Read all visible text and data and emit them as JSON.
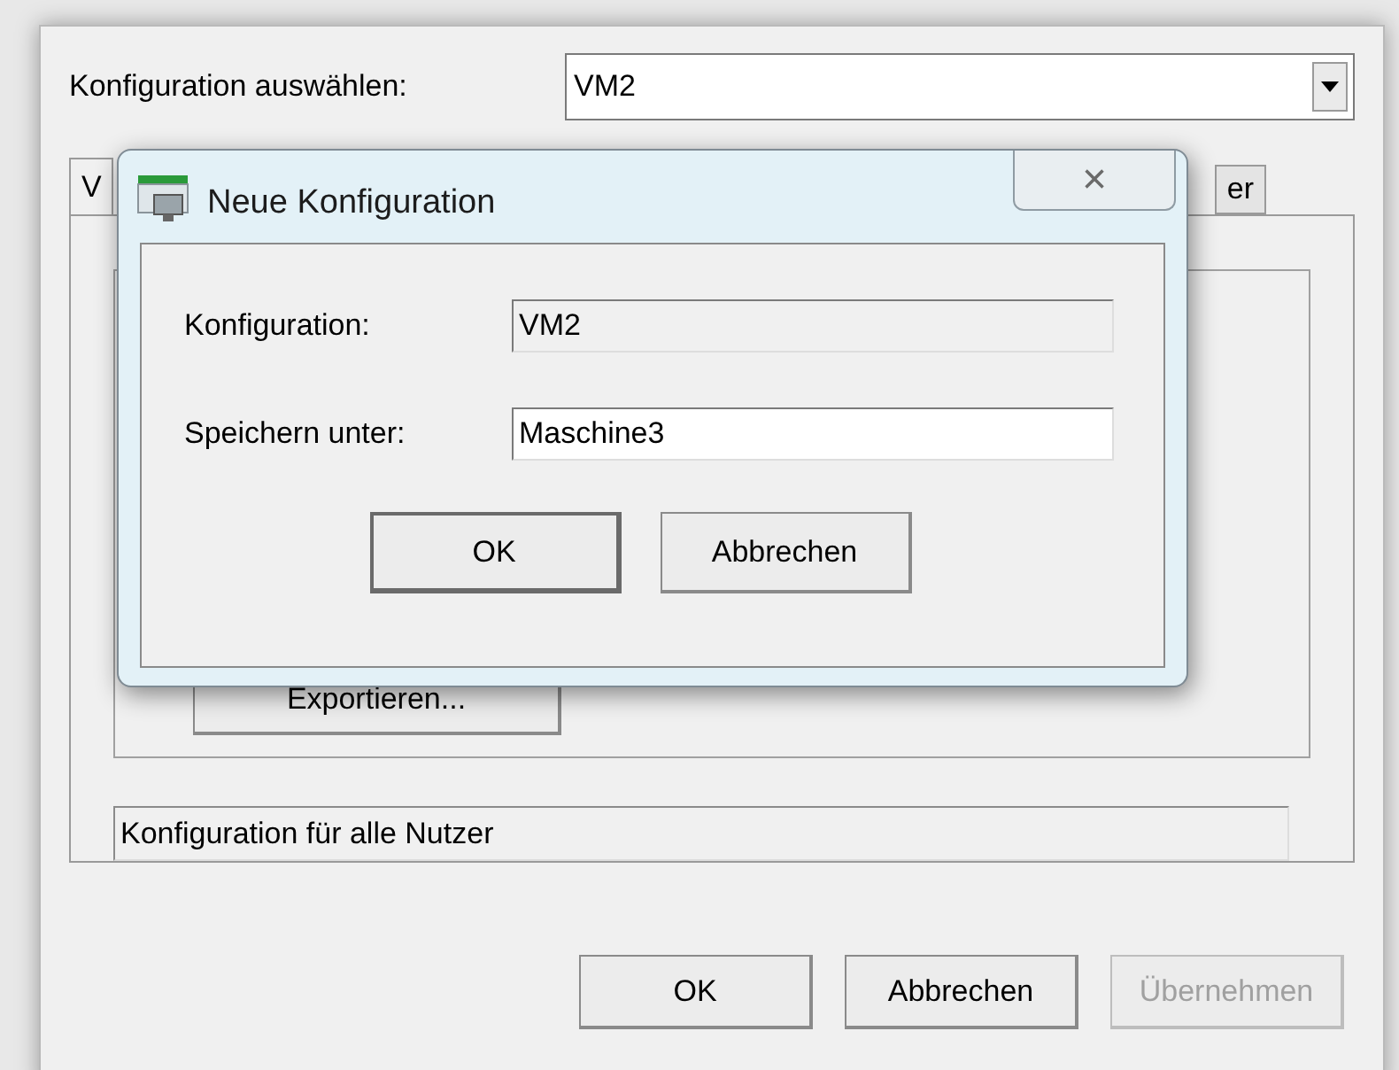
{
  "config_select": {
    "label": "Konfiguration auswählen:",
    "value": "VM2"
  },
  "tabs": [
    {
      "label": "V",
      "selected": true
    },
    {
      "label": "er",
      "selected": false
    }
  ],
  "export_button": "Exportieren...",
  "status_field": "Konfiguration für alle Nutzer",
  "buttons": [
    {
      "label": "OK",
      "disabled": false
    },
    {
      "label": "Abbrechen",
      "disabled": false
    },
    {
      "label": "Übernehmen",
      "disabled": true
    }
  ],
  "dialog": {
    "title": "Neue Konfiguration",
    "close": "×",
    "fields": [
      {
        "label": "Konfiguration:",
        "value": "VM2",
        "readonly": true
      },
      {
        "label": "Speichern unter:",
        "value": "Maschine3",
        "readonly": false
      }
    ],
    "buttons": [
      {
        "label": "OK",
        "default": true
      },
      {
        "label": "Abbrechen",
        "default": false
      }
    ]
  }
}
